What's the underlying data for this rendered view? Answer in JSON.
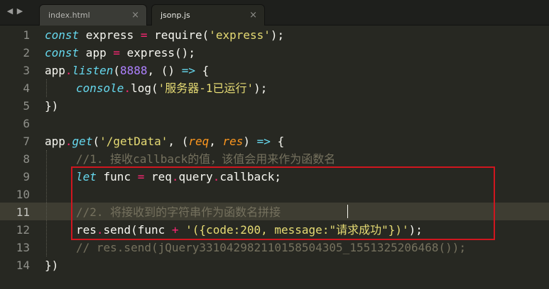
{
  "tabs": [
    {
      "label": "index.html",
      "close": "×",
      "active": false
    },
    {
      "label": "jsonp.js",
      "close": "×",
      "active": true
    }
  ],
  "nav": {
    "back": "◀",
    "forward": "▶"
  },
  "line_numbers": [
    "1",
    "2",
    "3",
    "4",
    "5",
    "6",
    "7",
    "8",
    "9",
    "10",
    "11",
    "12",
    "13",
    "14"
  ],
  "code": {
    "l1": {
      "kw": "const",
      "a": " express ",
      "op": "=",
      "b": " require(",
      "str": "'express'",
      "c": ");"
    },
    "l2": {
      "kw": "const",
      "a": " app ",
      "op": "=",
      "b": " express();"
    },
    "l3": {
      "a": "app",
      "op": ".",
      "fn": "listen",
      "b": "(",
      "num": "8888",
      "c": ", () ",
      "arrow": "=>",
      "d": " {"
    },
    "l4": {
      "fn": "console",
      "op": ".",
      "b": "log(",
      "str": "'服务器-1已运行'",
      "c": ");"
    },
    "l5": {
      "a": "})"
    },
    "l7": {
      "a": "app",
      "op": ".",
      "fn": "get",
      "b": "(",
      "str": "'/getData'",
      "c": ", (",
      "p1": "req",
      "d": ", ",
      "p2": "res",
      "e": ") ",
      "arrow": "=>",
      "f": " {"
    },
    "l8": {
      "cmt": "//1. 接收callback的值，该值会用来作为函数名"
    },
    "l9": {
      "kw": "let",
      "a": " func ",
      "op": "=",
      "b": " req",
      "op2": ".",
      "c": "query",
      "op3": ".",
      "d": "callback;"
    },
    "l11": {
      "cmt": "//2. 将接收到的字符串作为函数名拼接"
    },
    "l12": {
      "a": "res",
      "op": ".",
      "b": "send(func ",
      "op2": "+",
      "c": " ",
      "str": "'({code:200, message:\"请求成功\"})'",
      "d": ");"
    },
    "l13": {
      "cmt": "// res.send(jQuery33104298211015850430​5_1551325206468());"
    },
    "l14": {
      "a": "})"
    }
  },
  "colors": {
    "background": "#272822",
    "keyword": "#66d9ef",
    "operator": "#f92672",
    "string": "#e6db74",
    "number": "#ae81ff",
    "param": "#fd971f",
    "comment": "#75715e",
    "highlight_box": "#d0161f"
  }
}
